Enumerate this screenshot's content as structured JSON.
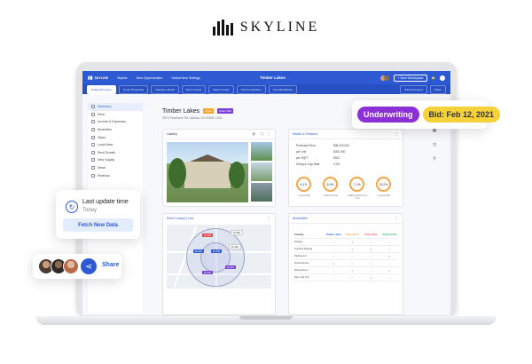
{
  "brand": {
    "name": "SKYLINE",
    "logo_icon": "skyline-bars-icon"
  },
  "app": {
    "logo_text": "SKYLINE",
    "nav": [
      "Skyline",
      "New Opportunities",
      "Global New Settings"
    ],
    "property_title": "Timber Lakes",
    "right_button": "+ New Workspace",
    "tabs": [
      "Subject Property",
      "Comp Properties",
      "Valuation Model",
      "Rent Comps",
      "Sales Comps",
      "Unit Comparison",
      "Amenities/Notes"
    ],
    "tab_actions": [
      "Add Document",
      "Share"
    ]
  },
  "sidebar": {
    "items": [
      "Summary",
      "Rent",
      "Income & Expenses",
      "Amenities",
      "Sales",
      "Local Area",
      "Rent Growth",
      "New Supply",
      "News",
      "Reviews"
    ]
  },
  "property": {
    "name": "Timber Lakes",
    "address": "2572 Peachtree Rd, Atlanta, GA 30305, USA",
    "badges": [
      {
        "label": "Active",
        "color": "#f4a52c"
      },
      {
        "label": "Under Offer",
        "color": "#7a3fd6"
      }
    ]
  },
  "gallery": {
    "title": "Gallery"
  },
  "model": {
    "title": "Model & Returns",
    "rows": [
      {
        "label": "Purchase Price",
        "value": "$38,000,000"
      },
      {
        "label": "per Unit",
        "value": "$200,000"
      },
      {
        "label": "per SQFT",
        "value": "$322"
      },
      {
        "label": "Going-in Cap Rate",
        "value": "4.3%"
      }
    ],
    "metrics": [
      {
        "value": "6.1%",
        "label": "Levered IRR"
      },
      {
        "value": "8.9%",
        "label": "Unlevered CoC"
      },
      {
        "value": "7.1%",
        "label": "Stabilized Return on Cost"
      },
      {
        "value": "15.2%",
        "label": "Levered IRR"
      }
    ]
  },
  "map": {
    "title": "Rent Comps",
    "subtitle": "List",
    "pins": [
      "$1,349",
      "$1,380",
      "$1,365",
      "$1,299",
      "$1,450",
      "$1,310",
      "$1,402"
    ]
  },
  "amenities": {
    "title": "Amenities",
    "columns": [
      "Amenity",
      "Timber Lakes",
      "Riverside Pl",
      "Pines Apts",
      "Park Central"
    ],
    "rows": [
      {
        "name": "Garage",
        "marks": [
          "check",
          "x",
          "check",
          "check"
        ]
      },
      {
        "name": "Covered Parking",
        "marks": [
          "check",
          "x",
          "x",
          "check"
        ]
      },
      {
        "name": "Parking Lot",
        "marks": [
          "check",
          "check",
          "check",
          "x"
        ]
      },
      {
        "name": "Fitness Room",
        "marks": [
          "x",
          "check",
          "check",
          "check"
        ]
      },
      {
        "name": "Dining Room",
        "marks": [
          "check",
          "x",
          "check",
          "x"
        ]
      },
      {
        "name": "Spa / Hot Tub",
        "marks": [
          "check",
          "check",
          "x",
          "check"
        ]
      }
    ]
  },
  "status": {
    "stage": "Underwriting",
    "stage_color": "#8b2fd6",
    "bid": "Bid: Feb 12, 2021",
    "bid_color": "#f6d13a"
  },
  "update": {
    "title": "Last update time",
    "when": "Today",
    "button": "Fetch New Data"
  },
  "share": {
    "label": "Share"
  },
  "colors": {
    "primary": "#2d5ad3",
    "accent": "#f2a54a"
  }
}
